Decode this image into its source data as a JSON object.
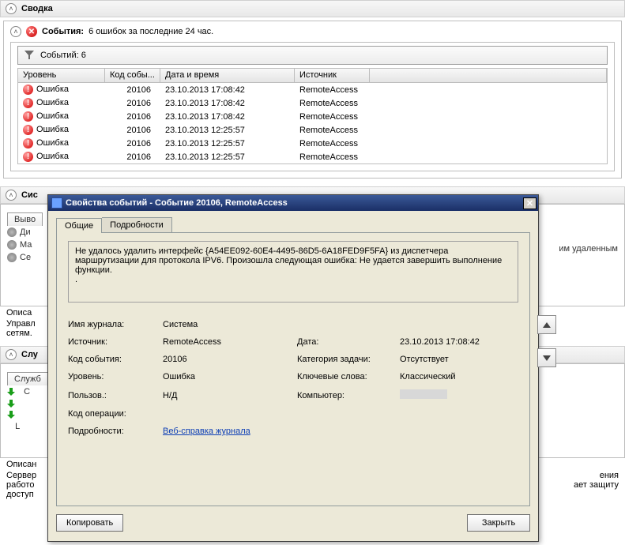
{
  "summary": {
    "title": "Сводка"
  },
  "events_header": {
    "label": "События:",
    "summary": "6 ошибок за последние 24 час."
  },
  "filter": {
    "count_label": "Событий: 6"
  },
  "table": {
    "headers": {
      "level": "Уровень",
      "code": "Код собы...",
      "date": "Дата и время",
      "source": "Источник"
    },
    "rows": [
      {
        "level": "Ошибка",
        "code": "20106",
        "date": "23.10.2013 17:08:42",
        "source": "RemoteAccess"
      },
      {
        "level": "Ошибка",
        "code": "20106",
        "date": "23.10.2013 17:08:42",
        "source": "RemoteAccess"
      },
      {
        "level": "Ошибка",
        "code": "20106",
        "date": "23.10.2013 17:08:42",
        "source": "RemoteAccess"
      },
      {
        "level": "Ошибка",
        "code": "20106",
        "date": "23.10.2013 12:25:57",
        "source": "RemoteAccess"
      },
      {
        "level": "Ошибка",
        "code": "20106",
        "date": "23.10.2013 12:25:57",
        "source": "RemoteAccess"
      },
      {
        "level": "Ошибка",
        "code": "20106",
        "date": "23.10.2013 12:25:57",
        "source": "RemoteAccess"
      }
    ]
  },
  "bg": {
    "sys_title": "Сис",
    "output_tab": "Выво",
    "rows": [
      "Ди",
      "Ма",
      "Се"
    ],
    "desc1": "Описа",
    "desc2": "Управл",
    "desc3": "сетям.",
    "right1": "им удаленным",
    "services_title": "Слу",
    "services_tab": "Служб",
    "svc_row": "С",
    "svc_L": "L",
    "foot1": "Описан",
    "foot2": "Сервер",
    "foot3": "работо",
    "foot4": "доступ",
    "right2": "ения",
    "right3": "ает защиту"
  },
  "dialog": {
    "title": "Свойства событий - Событие 20106, RemoteAccess",
    "tabs": {
      "general": "Общие",
      "details": "Подробности"
    },
    "description": "Не удалось удалить интерфейс {A54EE092-60E4-4495-86D5-6A18FED9F5FA} из диспетчера маршрутизации для протокола IPV6. Произошла следующая ошибка: Не удается завершить выполнение функции.\n.",
    "props": {
      "log_name_label": "Имя журнала:",
      "log_name": "Система",
      "source_label": "Источник:",
      "source": "RemoteAccess",
      "date_label": "Дата:",
      "date": "23.10.2013 17:08:42",
      "event_id_label": "Код события:",
      "event_id": "20106",
      "task_cat_label": "Категория задачи:",
      "task_cat": "Отсутствует",
      "level_label": "Уровень:",
      "level": "Ошибка",
      "keywords_label": "Ключевые слова:",
      "keywords": "Классический",
      "user_label": "Пользов.:",
      "user": "Н/Д",
      "computer_label": "Компьютер:",
      "computer": "",
      "opcode_label": "Код операции:",
      "moreinfo_label": "Подробности:",
      "moreinfo_link": "Веб-справка журнала"
    },
    "buttons": {
      "copy": "Копировать",
      "close": "Закрыть"
    }
  }
}
